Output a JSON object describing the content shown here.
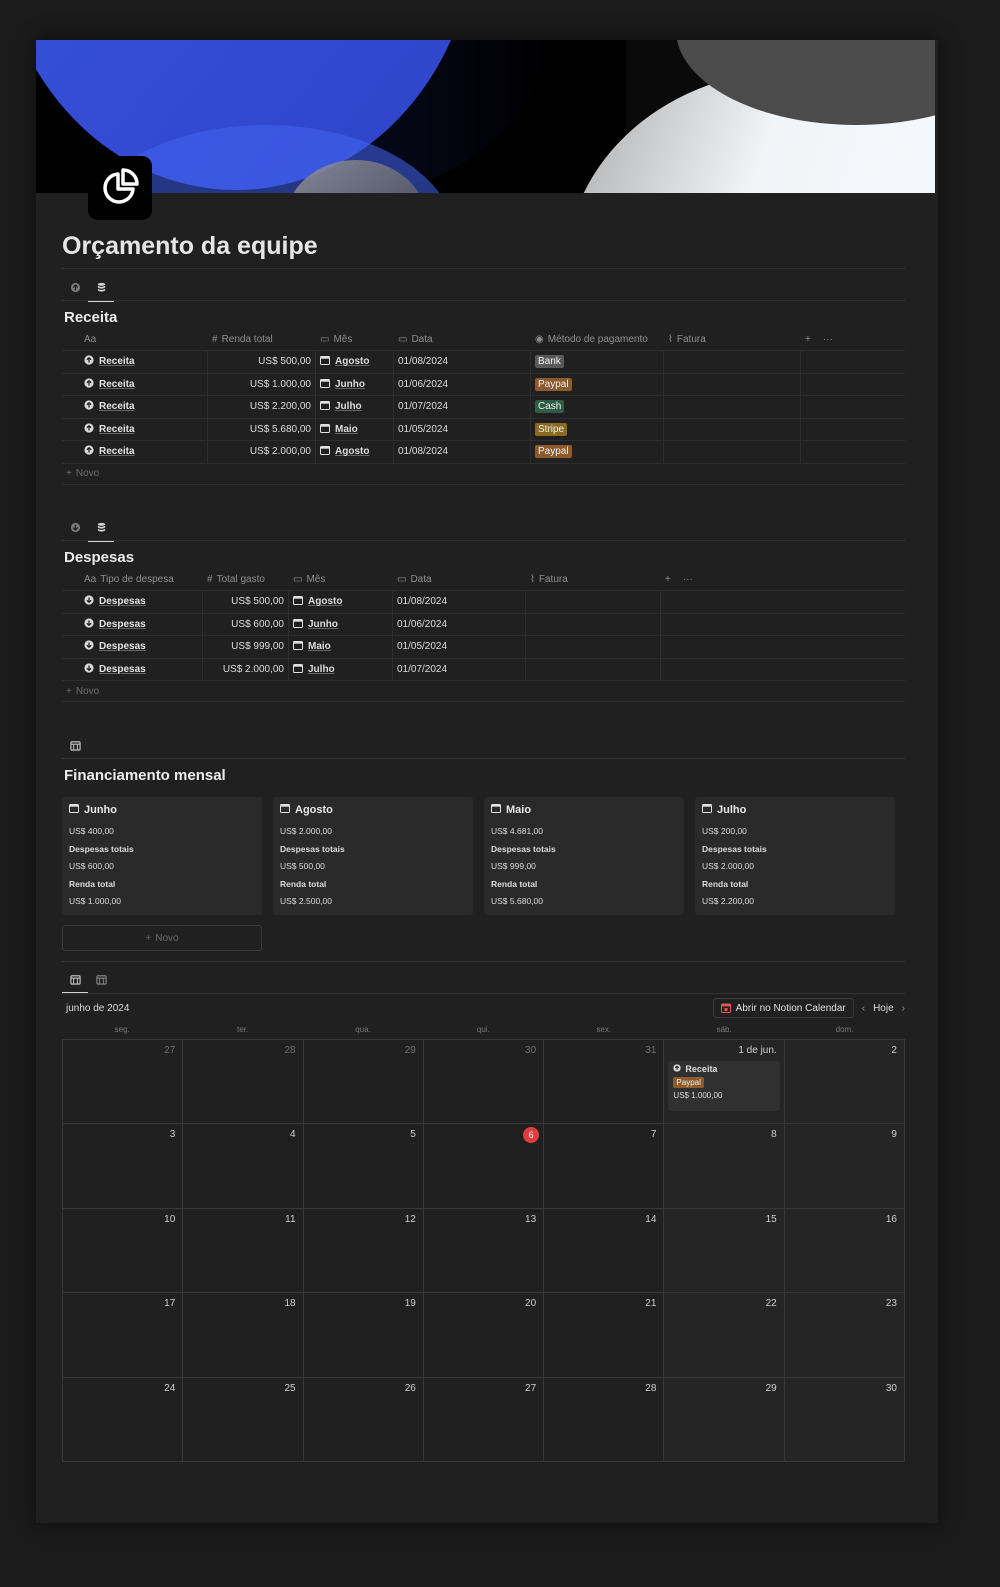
{
  "page": {
    "title": "Orçamento da equipe",
    "icon": "pie-chart-icon"
  },
  "colors": {
    "tag_bank": "#5a5a5a",
    "tag_paypal": "#8c5a2b",
    "tag_cash": "#2e5c45",
    "tag_stripe": "#8a6a1e",
    "today": "#e03e3e"
  },
  "receita": {
    "title": "Receita",
    "columns": [
      "Aa",
      "Renda total",
      "Mês",
      "Data",
      "Método de pagamento",
      "Fatura"
    ],
    "rows": [
      {
        "name": "Receita",
        "total": "US$ 500,00",
        "month": "Agosto",
        "date": "01/08/2024",
        "method": "Bank"
      },
      {
        "name": "Receita",
        "total": "US$ 1.000,00",
        "month": "Junho",
        "date": "01/06/2024",
        "method": "Paypal"
      },
      {
        "name": "Receita",
        "total": "US$ 2.200,00",
        "month": "Julho",
        "date": "01/07/2024",
        "method": "Cash"
      },
      {
        "name": "Receita",
        "total": "US$ 5.680,00",
        "month": "Maio",
        "date": "01/05/2024",
        "method": "Stripe"
      },
      {
        "name": "Receita",
        "total": "US$ 2.000,00",
        "month": "Agosto",
        "date": "01/08/2024",
        "method": "Paypal"
      }
    ],
    "new_label": "Novo"
  },
  "despesas": {
    "title": "Despesas",
    "columns": [
      "Aa",
      "Tipo de despesa",
      "Total gasto",
      "Mês",
      "Data",
      "Fatura"
    ],
    "rows": [
      {
        "name": "Despesas",
        "total": "US$ 500,00",
        "month": "Agosto",
        "date": "01/08/2024"
      },
      {
        "name": "Despesas",
        "total": "US$ 600,00",
        "month": "Junho",
        "date": "01/06/2024"
      },
      {
        "name": "Despesas",
        "total": "US$ 999,00",
        "month": "Maio",
        "date": "01/05/2024"
      },
      {
        "name": "Despesas",
        "total": "US$ 2.000,00",
        "month": "Julho",
        "date": "01/07/2024"
      }
    ],
    "new_label": "Novo"
  },
  "financiamento": {
    "title": "Financiamento mensal",
    "cards": [
      {
        "month": "Junho",
        "balance": "US$ 400,00",
        "expenses_label": "Despesas totais",
        "expenses": "US$ 600,00",
        "income_label": "Renda total",
        "income": "US$ 1.000,00"
      },
      {
        "month": "Agosto",
        "balance": "US$ 2.000,00",
        "expenses_label": "Despesas totais",
        "expenses": "US$ 500,00",
        "income_label": "Renda total",
        "income": "US$ 2.500,00"
      },
      {
        "month": "Maio",
        "balance": "US$ 4.681,00",
        "expenses_label": "Despesas totais",
        "expenses": "US$ 999,00",
        "income_label": "Renda total",
        "income": "US$ 5.680,00"
      },
      {
        "month": "Julho",
        "balance": "US$ 200,00",
        "expenses_label": "Despesas totais",
        "expenses": "US$ 2.000,00",
        "income_label": "Renda total",
        "income": "US$ 2.200,00"
      }
    ],
    "new_label": "Novo"
  },
  "calendar": {
    "month_label": "junho de 2024",
    "open_button": "Abrir no Notion Calendar",
    "today_button": "Hoje",
    "weekdays": [
      "seg.",
      "ter.",
      "qua.",
      "qui.",
      "sex.",
      "sáb.",
      "dom."
    ],
    "days": [
      {
        "label": "27",
        "muted": true
      },
      {
        "label": "28",
        "muted": true
      },
      {
        "label": "29",
        "muted": true
      },
      {
        "label": "30",
        "muted": true
      },
      {
        "label": "31",
        "muted": true
      },
      {
        "label": "1 de jun."
      },
      {
        "label": "2"
      },
      {
        "label": "3"
      },
      {
        "label": "4"
      },
      {
        "label": "5"
      },
      {
        "label": "6",
        "today": true
      },
      {
        "label": "7"
      },
      {
        "label": "8"
      },
      {
        "label": "9"
      },
      {
        "label": "10"
      },
      {
        "label": "11"
      },
      {
        "label": "12"
      },
      {
        "label": "13"
      },
      {
        "label": "14"
      },
      {
        "label": "15"
      },
      {
        "label": "16"
      },
      {
        "label": "17"
      },
      {
        "label": "18"
      },
      {
        "label": "19"
      },
      {
        "label": "20"
      },
      {
        "label": "21"
      },
      {
        "label": "22"
      },
      {
        "label": "23"
      },
      {
        "label": "24"
      },
      {
        "label": "25"
      },
      {
        "label": "26"
      },
      {
        "label": "27"
      },
      {
        "label": "28"
      },
      {
        "label": "29"
      },
      {
        "label": "30"
      }
    ],
    "event": {
      "day_label": "1 de jun.",
      "title": "Receita",
      "tag": "Paypal",
      "amount": "US$ 1.000,00"
    }
  }
}
